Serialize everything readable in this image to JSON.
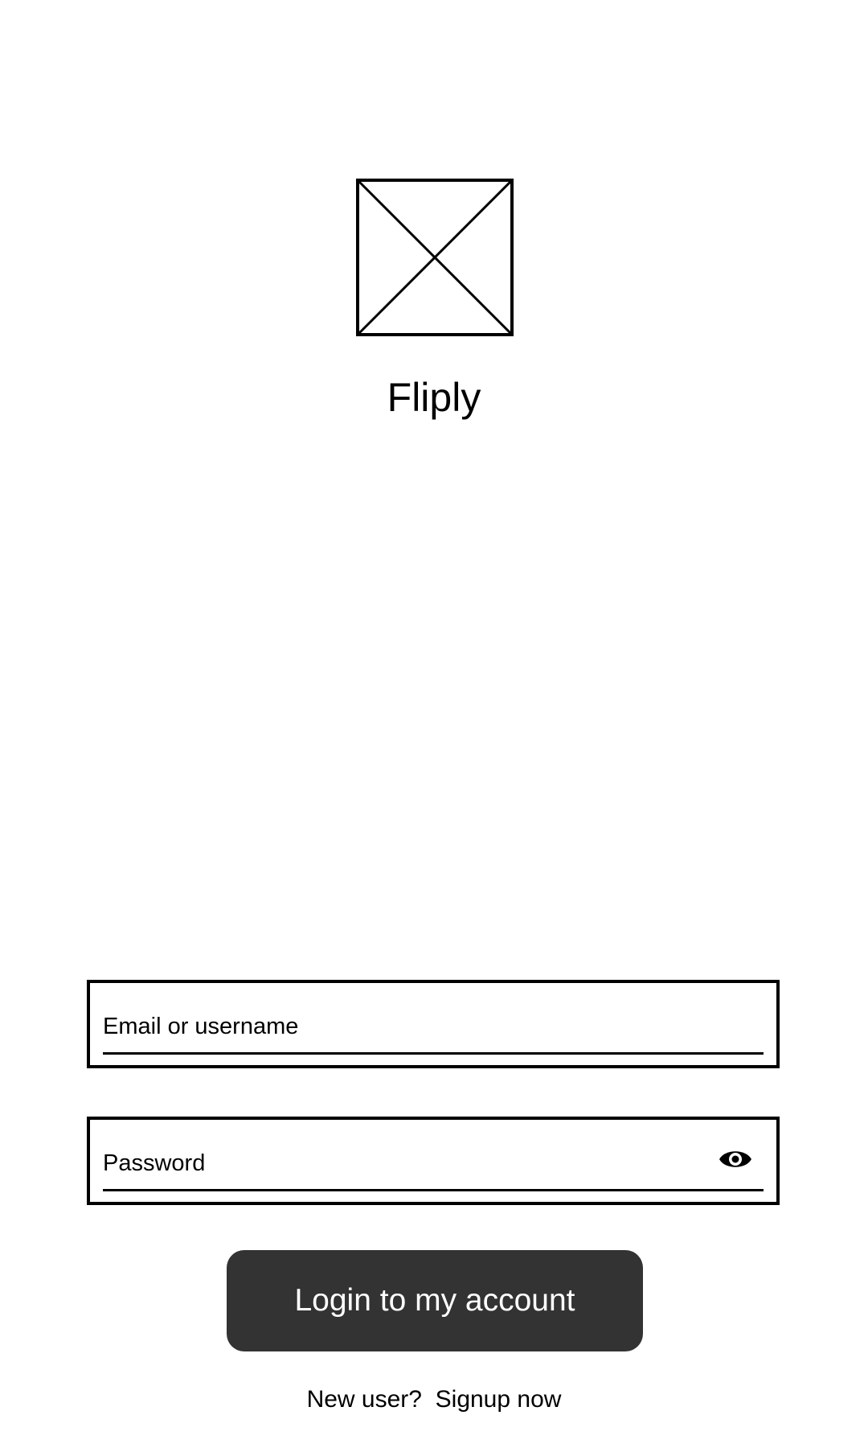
{
  "app": {
    "name": "Fliply",
    "logo_icon": "image-placeholder-icon"
  },
  "login_form": {
    "email_placeholder": "Email or username",
    "email_value": "",
    "password_placeholder": "Password",
    "password_value": "",
    "password_toggle_icon": "eye-icon",
    "submit_label": "Login to my account"
  },
  "signup": {
    "prompt": "New user?",
    "link_label": "Signup now"
  },
  "colors": {
    "background": "#ffffff",
    "text": "#000000",
    "button_background": "#333333",
    "button_text": "#ffffff"
  }
}
